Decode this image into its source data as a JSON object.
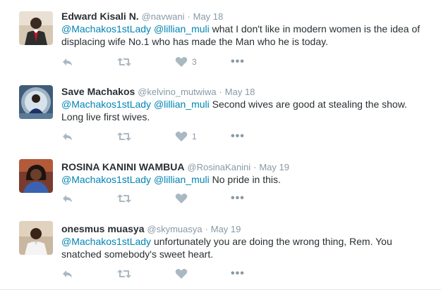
{
  "tweets": [
    {
      "name": "Edward Kisali N.",
      "handle": "@navwani",
      "sep": "·",
      "date": "May 18",
      "mentions": [
        "@Machakos1stLady",
        "@lillian_muli"
      ],
      "text": "what I don't like in modern women is the idea of displacing wife No.1 who has made the Man who he is today.",
      "likes": "3",
      "avatar_icon": "avatar-man-in-suit"
    },
    {
      "name": "Save Machakos",
      "handle": "@kelvino_mutwiwa",
      "sep": "·",
      "date": "May 18",
      "mentions": [
        "@Machakos1stLady",
        "@lillian_muli"
      ],
      "text": "Second wives are good at stealing the show. Long live first wives.",
      "likes": "1",
      "avatar_icon": "avatar-person-circle-frame"
    },
    {
      "name": "ROSINA KANINI WAMBUA",
      "handle": "@RosinaKanini",
      "sep": "·",
      "date": "May 19",
      "mentions": [
        "@Machakos1stLady",
        "@lillian_muli"
      ],
      "text": "No pride in this.",
      "likes": "",
      "avatar_icon": "avatar-woman"
    },
    {
      "name": "onesmus muasya",
      "handle": "@skymuasya",
      "sep": "·",
      "date": "May 19",
      "mentions": [
        "@Machakos1stLady"
      ],
      "text": "unfortunately you are doing the wrong thing, Rem. You snatched somebody's sweet heart.",
      "likes": "",
      "avatar_icon": "avatar-man-white-shirt"
    }
  ],
  "actions": {
    "reply_icon": "reply-icon",
    "retweet_icon": "retweet-icon",
    "like_icon": "heart-icon",
    "more_icon": "more-icon",
    "more_glyph": "•••"
  },
  "colors": {
    "mention": "#0084b4",
    "action_gray": "#aab8c2",
    "name": "#292f33",
    "meta": "#8899a6",
    "divider": "#e1e8ed"
  }
}
